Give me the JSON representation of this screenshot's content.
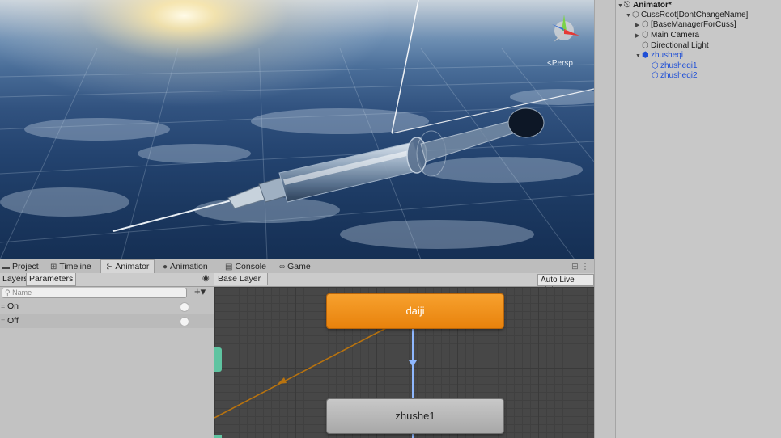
{
  "scene": {
    "persp_label": "<Persp"
  },
  "bottom_tabs": [
    {
      "label": "Project",
      "icon": "folder-icon"
    },
    {
      "label": "Timeline",
      "icon": "timeline-icon"
    },
    {
      "label": "Animator",
      "icon": "animator-icon",
      "active": true
    },
    {
      "label": "Animation",
      "icon": "animation-icon"
    },
    {
      "label": "Console",
      "icon": "console-icon"
    },
    {
      "label": "Game",
      "icon": "game-icon"
    }
  ],
  "params_panel": {
    "tab_layers": "Layers",
    "tab_parameters": "Parameters",
    "search_placeholder": "Name",
    "add_label": "+▾",
    "parameters": [
      {
        "name": "On"
      },
      {
        "name": "Off"
      }
    ]
  },
  "graph": {
    "breadcrumb": "Base Layer",
    "auto_live_link": "Auto Live Link",
    "states": {
      "daiji": "daiji",
      "zhushe1": "zhushe1"
    }
  },
  "hierarchy": {
    "root": "Animator*",
    "items": [
      {
        "label": "CussRoot[DontChangeName]"
      },
      {
        "label": "[BaseManagerForCuss]"
      },
      {
        "label": "Main Camera"
      },
      {
        "label": "Directional Light"
      },
      {
        "label": "zhusheqi"
      },
      {
        "label": "zhusheqi1"
      },
      {
        "label": "zhusheqi2"
      }
    ]
  },
  "colors": {
    "state_default": "#e8820c",
    "state_normal": "#a8a8a8",
    "transition": "#8fb8ff",
    "selected_link": "#1f4fd6"
  }
}
